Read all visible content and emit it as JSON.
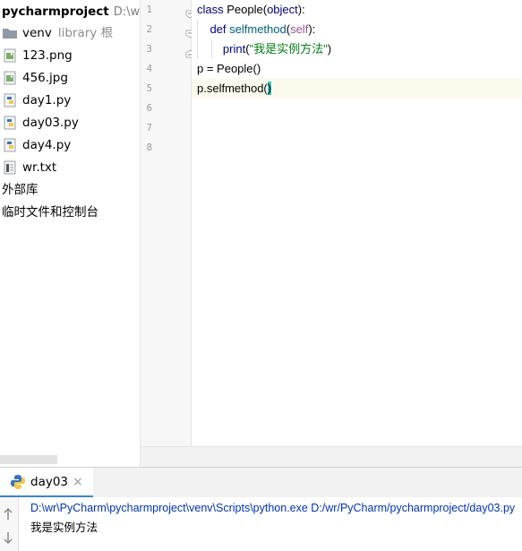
{
  "project": {
    "name": "pycharmproject",
    "path": "D:\\wr\\"
  },
  "tree": [
    {
      "label": "venv",
      "suffix": "library 根",
      "icon": "folder-icon"
    },
    {
      "label": "123.png",
      "icon": "image-file-icon"
    },
    {
      "label": "456.jpg",
      "icon": "image-file-icon"
    },
    {
      "label": "day1.py",
      "icon": "python-file-icon"
    },
    {
      "label": "day03.py",
      "icon": "python-file-icon"
    },
    {
      "label": "day4.py",
      "icon": "python-file-icon"
    },
    {
      "label": "wr.txt",
      "icon": "text-file-icon"
    }
  ],
  "tree_extra": [
    "外部库",
    "临时文件和控制台"
  ],
  "line_numbers": [
    "1",
    "2",
    "3",
    "4",
    "5",
    "6",
    "7",
    "8"
  ],
  "code": {
    "l1_kw": "class ",
    "l1_name": "People",
    "l1_p1": "(",
    "l1_base": "object",
    "l1_p2": "):",
    "l2_indent": "    ",
    "l2_kw": "def ",
    "l2_name": "selfmethod",
    "l2_p1": "(",
    "l2_self": "self",
    "l2_p2": "):",
    "l3_indent": "        ",
    "l3_fn": "print",
    "l3_p1": "(",
    "l3_str": "\"我是实例方法\"",
    "l3_p2": ")",
    "l4": "p = People()",
    "l5_a": "p.selfmethod(",
    "l5_b": ")"
  },
  "run": {
    "tab_label": "day03",
    "close_glyph": "×",
    "command": "D:\\wr\\PyCharm\\pycharmproject\\venv\\Scripts\\python.exe D:/wr/PyCharm/pycharmproject/day03.py",
    "output": "我是实例方法"
  },
  "colors": {
    "keyword": "#000080",
    "function_name": "#00627a",
    "self": "#94558d",
    "string": "#067d17",
    "current_line": "#fcfaed",
    "brace_match": "#3fc4c4"
  }
}
